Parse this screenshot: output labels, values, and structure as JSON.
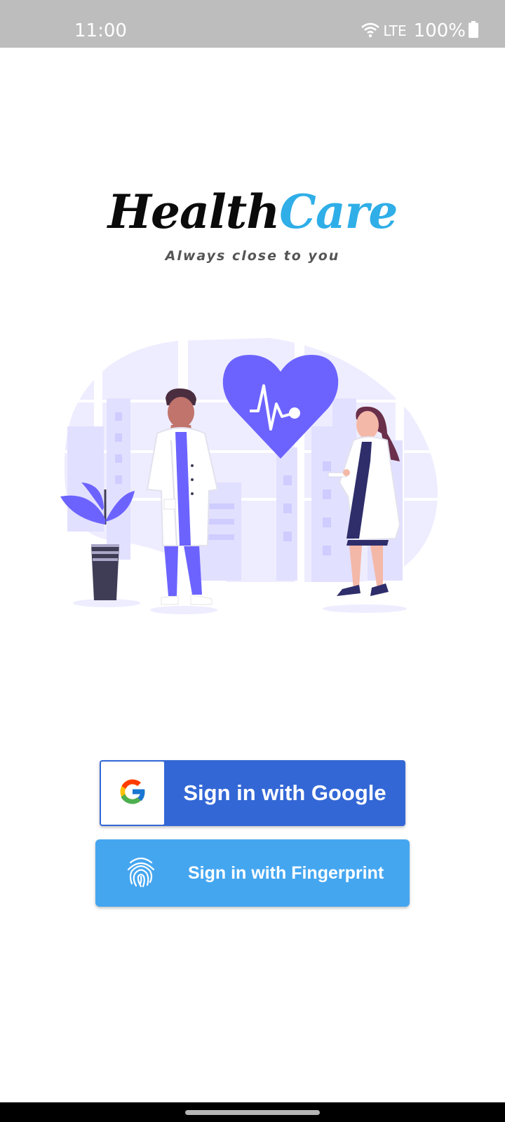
{
  "status_bar": {
    "time": "11:00",
    "network": "LTE",
    "battery": "100%",
    "icons": [
      "wifi-icon",
      "battery-icon"
    ]
  },
  "logo": {
    "part1": "Health",
    "part2": "Care",
    "tagline": "Always close to you"
  },
  "buttons": {
    "google": "Sign in with Google",
    "fingerprint": "Sign in with Fingerprint"
  },
  "colors": {
    "accent_purple": "#6c63ff",
    "google_button": "#3367d6",
    "fingerprint_button": "#45a6f0",
    "logo_care": "#2faee8"
  }
}
